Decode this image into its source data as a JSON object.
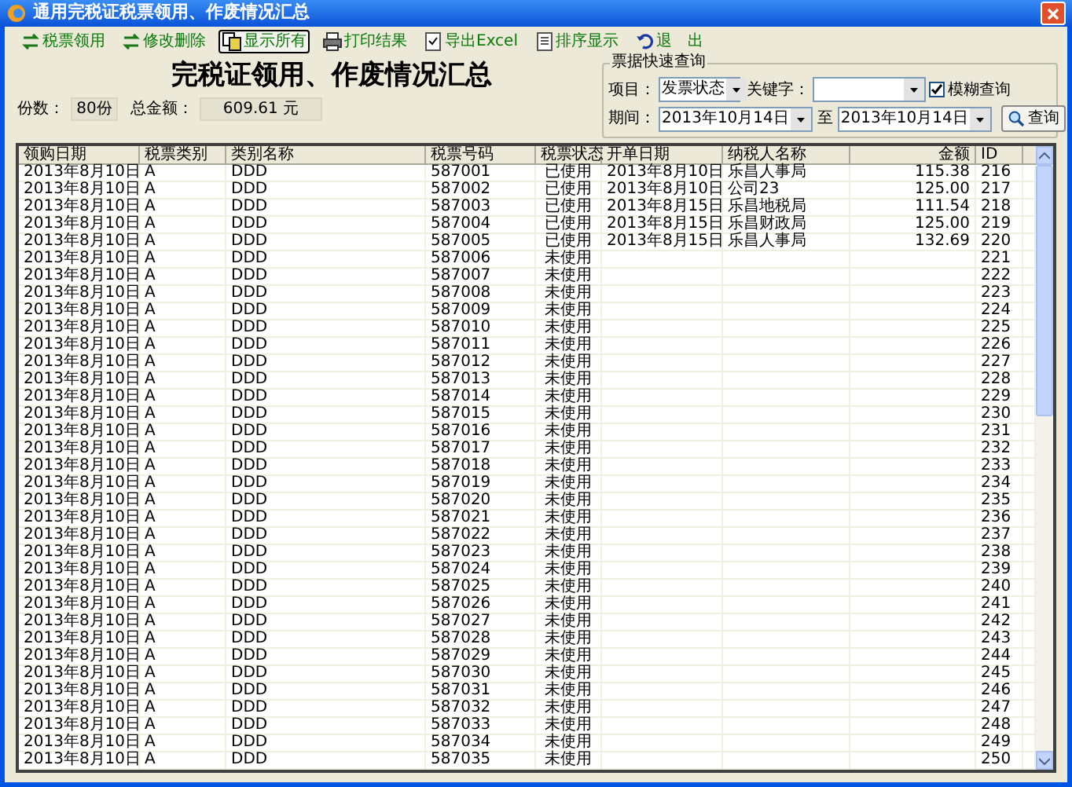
{
  "window": {
    "title": "通用完税证税票领用、作废情况汇总"
  },
  "toolbar": [
    {
      "label": "税票领用",
      "kind": "swap",
      "selected": false
    },
    {
      "label": "修改删除",
      "kind": "swap",
      "selected": false
    },
    {
      "label": "显示所有",
      "kind": "pages",
      "selected": true
    },
    {
      "label": "打印结果",
      "kind": "printer",
      "selected": false
    },
    {
      "label": "导出Excel",
      "kind": "export",
      "selected": false
    },
    {
      "label": "排序显示",
      "kind": "doc",
      "selected": false
    },
    {
      "label": "退　出",
      "kind": "undo",
      "selected": false
    }
  ],
  "heading": "完税证领用、作废情况汇总",
  "summary": {
    "count_label": "份数：",
    "count": "80份",
    "total_label": "总金额：",
    "total": "609.61 元"
  },
  "query": {
    "title": "票据快速查询",
    "item_label": "项目：",
    "item_value": "发票状态",
    "keyword_label": "关键字：",
    "fuzzy_label": "模糊查询",
    "fuzzy_checked": true,
    "period_label": "期间：",
    "from": "2013年10月14日",
    "to_label": "至",
    "to": "2013年10月14日",
    "button": "查询"
  },
  "table": {
    "columns": [
      "领购日期",
      "税票类别",
      "类别名称",
      "税票号码",
      "税票状态",
      "开单日期",
      "纳税人名称",
      "金额",
      "ID"
    ],
    "rows": [
      [
        "2013年8月10日",
        "A",
        "DDD",
        "587001",
        "已使用",
        "2013年8月10日",
        "乐昌人事局",
        "115.38",
        "216"
      ],
      [
        "2013年8月10日",
        "A",
        "DDD",
        "587002",
        "已使用",
        "2013年8月10日",
        "公司23",
        "125.00",
        "217"
      ],
      [
        "2013年8月10日",
        "A",
        "DDD",
        "587003",
        "已使用",
        "2013年8月15日",
        "乐昌地税局",
        "111.54",
        "218"
      ],
      [
        "2013年8月10日",
        "A",
        "DDD",
        "587004",
        "已使用",
        "2013年8月15日",
        "乐昌财政局",
        "125.00",
        "219"
      ],
      [
        "2013年8月10日",
        "A",
        "DDD",
        "587005",
        "已使用",
        "2013年8月15日",
        "乐昌人事局",
        "132.69",
        "220"
      ],
      [
        "2013年8月10日",
        "A",
        "DDD",
        "587006",
        "未使用",
        "",
        "",
        "",
        "221"
      ],
      [
        "2013年8月10日",
        "A",
        "DDD",
        "587007",
        "未使用",
        "",
        "",
        "",
        "222"
      ],
      [
        "2013年8月10日",
        "A",
        "DDD",
        "587008",
        "未使用",
        "",
        "",
        "",
        "223"
      ],
      [
        "2013年8月10日",
        "A",
        "DDD",
        "587009",
        "未使用",
        "",
        "",
        "",
        "224"
      ],
      [
        "2013年8月10日",
        "A",
        "DDD",
        "587010",
        "未使用",
        "",
        "",
        "",
        "225"
      ],
      [
        "2013年8月10日",
        "A",
        "DDD",
        "587011",
        "未使用",
        "",
        "",
        "",
        "226"
      ],
      [
        "2013年8月10日",
        "A",
        "DDD",
        "587012",
        "未使用",
        "",
        "",
        "",
        "227"
      ],
      [
        "2013年8月10日",
        "A",
        "DDD",
        "587013",
        "未使用",
        "",
        "",
        "",
        "228"
      ],
      [
        "2013年8月10日",
        "A",
        "DDD",
        "587014",
        "未使用",
        "",
        "",
        "",
        "229"
      ],
      [
        "2013年8月10日",
        "A",
        "DDD",
        "587015",
        "未使用",
        "",
        "",
        "",
        "230"
      ],
      [
        "2013年8月10日",
        "A",
        "DDD",
        "587016",
        "未使用",
        "",
        "",
        "",
        "231"
      ],
      [
        "2013年8月10日",
        "A",
        "DDD",
        "587017",
        "未使用",
        "",
        "",
        "",
        "232"
      ],
      [
        "2013年8月10日",
        "A",
        "DDD",
        "587018",
        "未使用",
        "",
        "",
        "",
        "233"
      ],
      [
        "2013年8月10日",
        "A",
        "DDD",
        "587019",
        "未使用",
        "",
        "",
        "",
        "234"
      ],
      [
        "2013年8月10日",
        "A",
        "DDD",
        "587020",
        "未使用",
        "",
        "",
        "",
        "235"
      ],
      [
        "2013年8月10日",
        "A",
        "DDD",
        "587021",
        "未使用",
        "",
        "",
        "",
        "236"
      ],
      [
        "2013年8月10日",
        "A",
        "DDD",
        "587022",
        "未使用",
        "",
        "",
        "",
        "237"
      ],
      [
        "2013年8月10日",
        "A",
        "DDD",
        "587023",
        "未使用",
        "",
        "",
        "",
        "238"
      ],
      [
        "2013年8月10日",
        "A",
        "DDD",
        "587024",
        "未使用",
        "",
        "",
        "",
        "239"
      ],
      [
        "2013年8月10日",
        "A",
        "DDD",
        "587025",
        "未使用",
        "",
        "",
        "",
        "240"
      ],
      [
        "2013年8月10日",
        "A",
        "DDD",
        "587026",
        "未使用",
        "",
        "",
        "",
        "241"
      ],
      [
        "2013年8月10日",
        "A",
        "DDD",
        "587027",
        "未使用",
        "",
        "",
        "",
        "242"
      ],
      [
        "2013年8月10日",
        "A",
        "DDD",
        "587028",
        "未使用",
        "",
        "",
        "",
        "243"
      ],
      [
        "2013年8月10日",
        "A",
        "DDD",
        "587029",
        "未使用",
        "",
        "",
        "",
        "244"
      ],
      [
        "2013年8月10日",
        "A",
        "DDD",
        "587030",
        "未使用",
        "",
        "",
        "",
        "245"
      ],
      [
        "2013年8月10日",
        "A",
        "DDD",
        "587031",
        "未使用",
        "",
        "",
        "",
        "246"
      ],
      [
        "2013年8月10日",
        "A",
        "DDD",
        "587032",
        "未使用",
        "",
        "",
        "",
        "247"
      ],
      [
        "2013年8月10日",
        "A",
        "DDD",
        "587033",
        "未使用",
        "",
        "",
        "",
        "248"
      ],
      [
        "2013年8月10日",
        "A",
        "DDD",
        "587034",
        "未使用",
        "",
        "",
        "",
        "249"
      ],
      [
        "2013年8月10日",
        "A",
        "DDD",
        "587035",
        "未使用",
        "",
        "",
        "",
        "250"
      ]
    ]
  }
}
